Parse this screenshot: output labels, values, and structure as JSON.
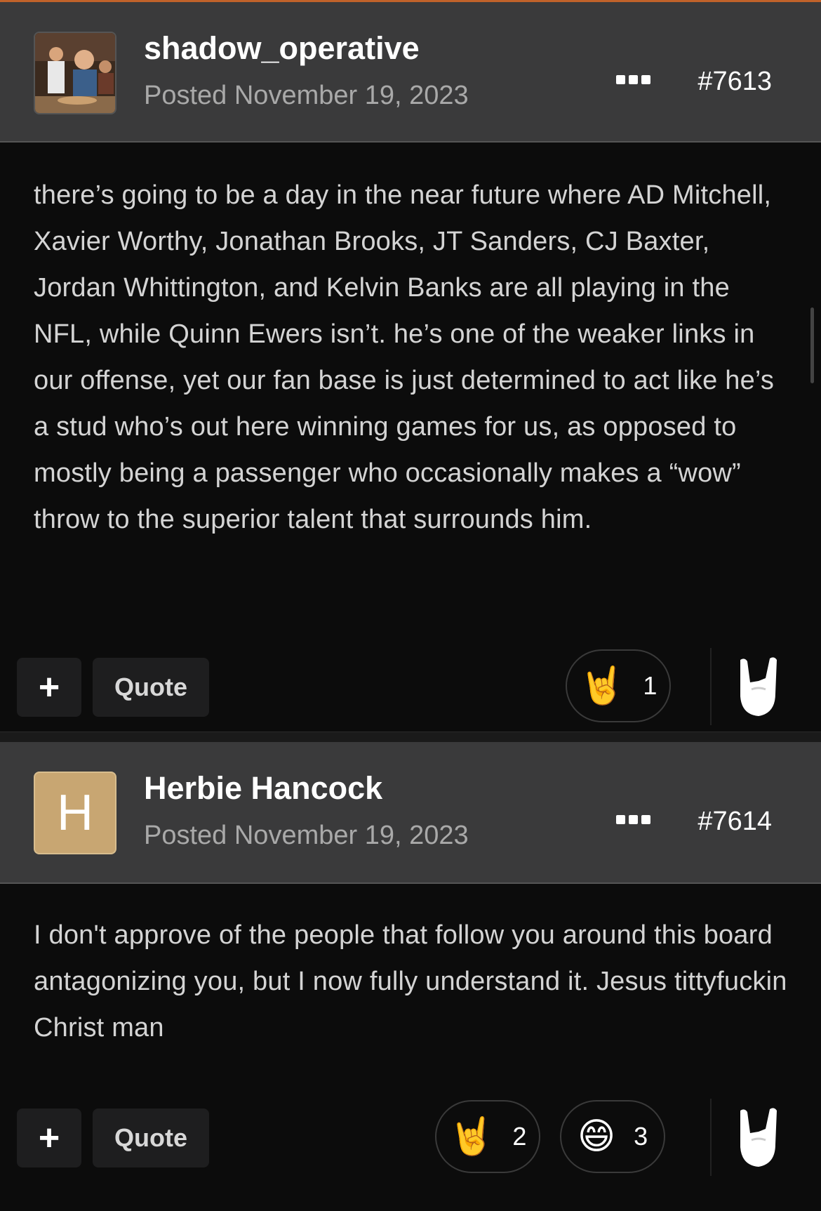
{
  "posts": [
    {
      "username": "shadow_operative",
      "posted": "Posted November 19, 2023",
      "post_number": "#7613",
      "avatar": "photo-avatar",
      "body": "there’s going to be a day in the near future where AD Mitchell, Xavier Worthy, Jonathan Brooks, JT Sanders, CJ Baxter, Jordan Whittington, and Kelvin Banks are all playing in the NFL, while Quinn Ewers isn’t. he’s one of the weaker links in our offense, yet our fan base is just determined to act like he’s a stud who’s out here winning games for us, as opposed to mostly being a passenger who occasionally makes a “wow” throw to the superior talent that surrounds him.",
      "plus_label": "+",
      "quote_label": "Quote",
      "reactions": [
        {
          "emoji": "🤘",
          "count": "1",
          "icon": "rock-on-icon"
        }
      ]
    },
    {
      "username": "Herbie Hancock",
      "posted": "Posted November 19, 2023",
      "post_number": "#7614",
      "avatar_letter": "H",
      "avatar_color": "#c8a672",
      "body": "I don't approve of the people that follow you around this board antagonizing you, but I now fully understand it. Jesus tittyfuckin Christ man",
      "plus_label": "+",
      "quote_label": "Quote",
      "reactions": [
        {
          "emoji": "🤘",
          "count": "2",
          "icon": "rock-on-icon"
        },
        {
          "emoji": "😄",
          "count": "3",
          "icon": "laughing-face-icon"
        }
      ]
    }
  ],
  "accent_color": "#c0622a"
}
